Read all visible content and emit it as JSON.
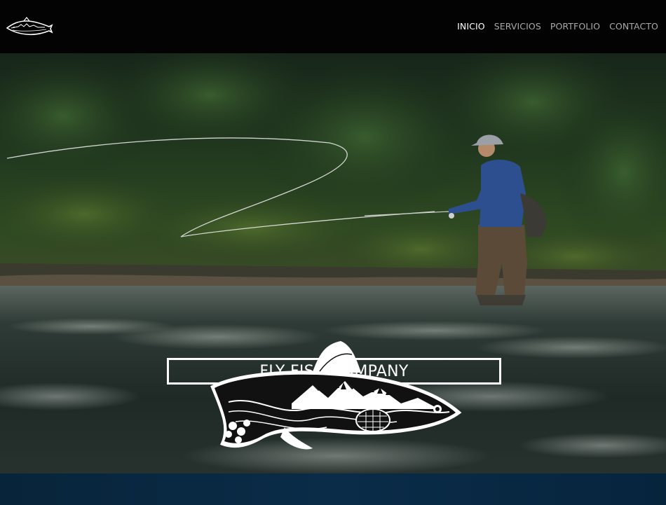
{
  "header": {
    "logo_icon": "trout-logo-icon",
    "nav": [
      {
        "label": "INICIO",
        "active": true
      },
      {
        "label": "SERVICIOS",
        "active": false
      },
      {
        "label": "PORTFOLIO",
        "active": false
      },
      {
        "label": "CONTACTO",
        "active": false
      }
    ]
  },
  "hero": {
    "title": "FLY FISH COMPANY",
    "emblem_icon": "trout-emblem-icon",
    "photo": "fly-fisherman-casting-in-river"
  },
  "colors": {
    "header_bg": "#030303",
    "nav_active": "#ffffff",
    "nav_inactive": "#a9a9a9",
    "footer_band": "#0a2c48"
  }
}
